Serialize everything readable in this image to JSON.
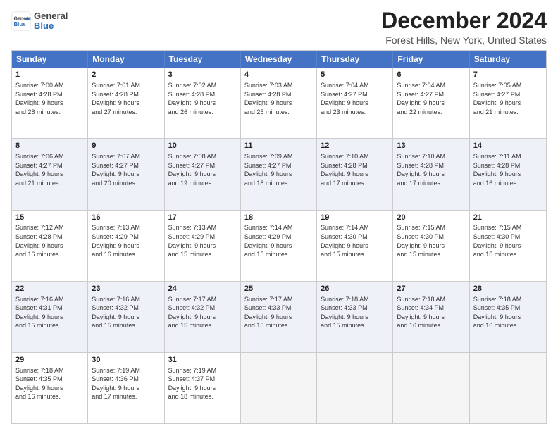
{
  "header": {
    "logo_general": "General",
    "logo_blue": "Blue",
    "title": "December 2024",
    "subtitle": "Forest Hills, New York, United States"
  },
  "days_of_week": [
    "Sunday",
    "Monday",
    "Tuesday",
    "Wednesday",
    "Thursday",
    "Friday",
    "Saturday"
  ],
  "weeks": [
    [
      {
        "day": "1",
        "info": "Sunrise: 7:00 AM\nSunset: 4:28 PM\nDaylight: 9 hours\nand 28 minutes."
      },
      {
        "day": "2",
        "info": "Sunrise: 7:01 AM\nSunset: 4:28 PM\nDaylight: 9 hours\nand 27 minutes."
      },
      {
        "day": "3",
        "info": "Sunrise: 7:02 AM\nSunset: 4:28 PM\nDaylight: 9 hours\nand 26 minutes."
      },
      {
        "day": "4",
        "info": "Sunrise: 7:03 AM\nSunset: 4:28 PM\nDaylight: 9 hours\nand 25 minutes."
      },
      {
        "day": "5",
        "info": "Sunrise: 7:04 AM\nSunset: 4:27 PM\nDaylight: 9 hours\nand 23 minutes."
      },
      {
        "day": "6",
        "info": "Sunrise: 7:04 AM\nSunset: 4:27 PM\nDaylight: 9 hours\nand 22 minutes."
      },
      {
        "day": "7",
        "info": "Sunrise: 7:05 AM\nSunset: 4:27 PM\nDaylight: 9 hours\nand 21 minutes."
      }
    ],
    [
      {
        "day": "8",
        "info": "Sunrise: 7:06 AM\nSunset: 4:27 PM\nDaylight: 9 hours\nand 21 minutes."
      },
      {
        "day": "9",
        "info": "Sunrise: 7:07 AM\nSunset: 4:27 PM\nDaylight: 9 hours\nand 20 minutes."
      },
      {
        "day": "10",
        "info": "Sunrise: 7:08 AM\nSunset: 4:27 PM\nDaylight: 9 hours\nand 19 minutes."
      },
      {
        "day": "11",
        "info": "Sunrise: 7:09 AM\nSunset: 4:27 PM\nDaylight: 9 hours\nand 18 minutes."
      },
      {
        "day": "12",
        "info": "Sunrise: 7:10 AM\nSunset: 4:28 PM\nDaylight: 9 hours\nand 17 minutes."
      },
      {
        "day": "13",
        "info": "Sunrise: 7:10 AM\nSunset: 4:28 PM\nDaylight: 9 hours\nand 17 minutes."
      },
      {
        "day": "14",
        "info": "Sunrise: 7:11 AM\nSunset: 4:28 PM\nDaylight: 9 hours\nand 16 minutes."
      }
    ],
    [
      {
        "day": "15",
        "info": "Sunrise: 7:12 AM\nSunset: 4:28 PM\nDaylight: 9 hours\nand 16 minutes."
      },
      {
        "day": "16",
        "info": "Sunrise: 7:13 AM\nSunset: 4:29 PM\nDaylight: 9 hours\nand 16 minutes."
      },
      {
        "day": "17",
        "info": "Sunrise: 7:13 AM\nSunset: 4:29 PM\nDaylight: 9 hours\nand 15 minutes."
      },
      {
        "day": "18",
        "info": "Sunrise: 7:14 AM\nSunset: 4:29 PM\nDaylight: 9 hours\nand 15 minutes."
      },
      {
        "day": "19",
        "info": "Sunrise: 7:14 AM\nSunset: 4:30 PM\nDaylight: 9 hours\nand 15 minutes."
      },
      {
        "day": "20",
        "info": "Sunrise: 7:15 AM\nSunset: 4:30 PM\nDaylight: 9 hours\nand 15 minutes."
      },
      {
        "day": "21",
        "info": "Sunrise: 7:15 AM\nSunset: 4:30 PM\nDaylight: 9 hours\nand 15 minutes."
      }
    ],
    [
      {
        "day": "22",
        "info": "Sunrise: 7:16 AM\nSunset: 4:31 PM\nDaylight: 9 hours\nand 15 minutes."
      },
      {
        "day": "23",
        "info": "Sunrise: 7:16 AM\nSunset: 4:32 PM\nDaylight: 9 hours\nand 15 minutes."
      },
      {
        "day": "24",
        "info": "Sunrise: 7:17 AM\nSunset: 4:32 PM\nDaylight: 9 hours\nand 15 minutes."
      },
      {
        "day": "25",
        "info": "Sunrise: 7:17 AM\nSunset: 4:33 PM\nDaylight: 9 hours\nand 15 minutes."
      },
      {
        "day": "26",
        "info": "Sunrise: 7:18 AM\nSunset: 4:33 PM\nDaylight: 9 hours\nand 15 minutes."
      },
      {
        "day": "27",
        "info": "Sunrise: 7:18 AM\nSunset: 4:34 PM\nDaylight: 9 hours\nand 16 minutes."
      },
      {
        "day": "28",
        "info": "Sunrise: 7:18 AM\nSunset: 4:35 PM\nDaylight: 9 hours\nand 16 minutes."
      }
    ],
    [
      {
        "day": "29",
        "info": "Sunrise: 7:18 AM\nSunset: 4:35 PM\nDaylight: 9 hours\nand 16 minutes."
      },
      {
        "day": "30",
        "info": "Sunrise: 7:19 AM\nSunset: 4:36 PM\nDaylight: 9 hours\nand 17 minutes."
      },
      {
        "day": "31",
        "info": "Sunrise: 7:19 AM\nSunset: 4:37 PM\nDaylight: 9 hours\nand 18 minutes."
      },
      {
        "day": "",
        "info": ""
      },
      {
        "day": "",
        "info": ""
      },
      {
        "day": "",
        "info": ""
      },
      {
        "day": "",
        "info": ""
      }
    ]
  ]
}
